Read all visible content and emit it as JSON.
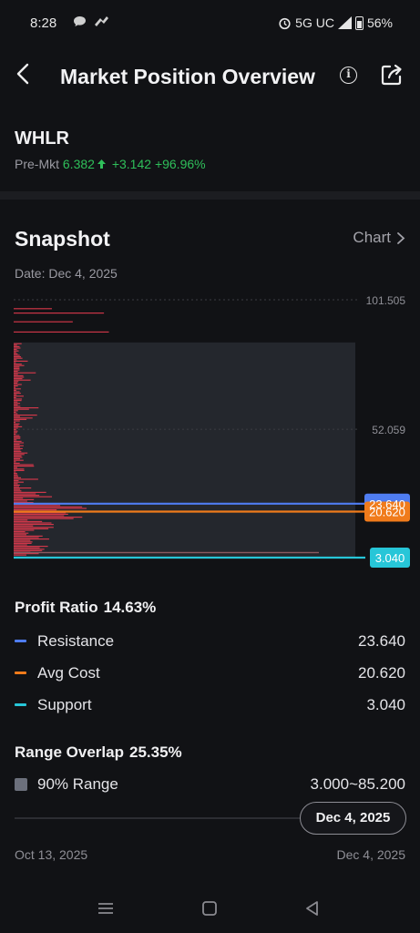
{
  "status_bar": {
    "time": "8:28",
    "notification_icons": [
      "chat-icon",
      "bird-icon"
    ],
    "network": "5G UC",
    "battery": "56%",
    "battery_level": 0.56
  },
  "header": {
    "title": "Market Position Overview",
    "back_icon": "chevron-left-icon",
    "info_icon": "info-icon",
    "share_icon": "share-icon"
  },
  "ticker": {
    "symbol": "WHLR",
    "session": "Pre-Mkt",
    "price": "6.382",
    "change": "+3.142",
    "change_pct": "+96.96%",
    "up_color": "#2fbf5a"
  },
  "snapshot": {
    "title": "Snapshot",
    "chart_link": "Chart",
    "date_label": "Date: Dec 4, 2025"
  },
  "chart_data": {
    "type": "bar",
    "orientation": "horizontal",
    "y_axis_labels": [
      "101.505",
      "52.059"
    ],
    "ylim": [
      3.04,
      101.505
    ],
    "markers": [
      {
        "name": "Resistance",
        "value": 23.64,
        "label": "23.640",
        "color": "#4f7df2"
      },
      {
        "name": "Avg Cost",
        "value": 20.62,
        "label": "20.620",
        "color": "#f07b1b"
      },
      {
        "name": "Support",
        "value": 3.04,
        "label": "3.040",
        "color": "#27c6d8"
      }
    ],
    "range_90": [
      3.0,
      85.2
    ],
    "bar_color": "#e03a4d"
  },
  "metrics": {
    "profit_ratio_label": "Profit Ratio",
    "profit_ratio_value": "14.63%",
    "rows": [
      {
        "label": "Resistance",
        "value": "23.640",
        "color": "#4f7df2"
      },
      {
        "label": "Avg Cost",
        "value": "20.620",
        "color": "#f07b1b"
      },
      {
        "label": "Support",
        "value": "3.040",
        "color": "#27c6d8"
      }
    ],
    "range_overlap_label": "Range Overlap",
    "range_overlap_value": "25.35%",
    "range_row": {
      "label": "90% Range",
      "value": "3.000~85.200"
    }
  },
  "slider": {
    "selected": "Dec 4, 2025",
    "start_label": "Oct 13, 2025",
    "end_label": "Dec 4, 2025"
  },
  "nav": {
    "recent_icon": "recent-apps-icon",
    "home_icon": "home-icon",
    "back_icon": "back-triangle-icon"
  }
}
